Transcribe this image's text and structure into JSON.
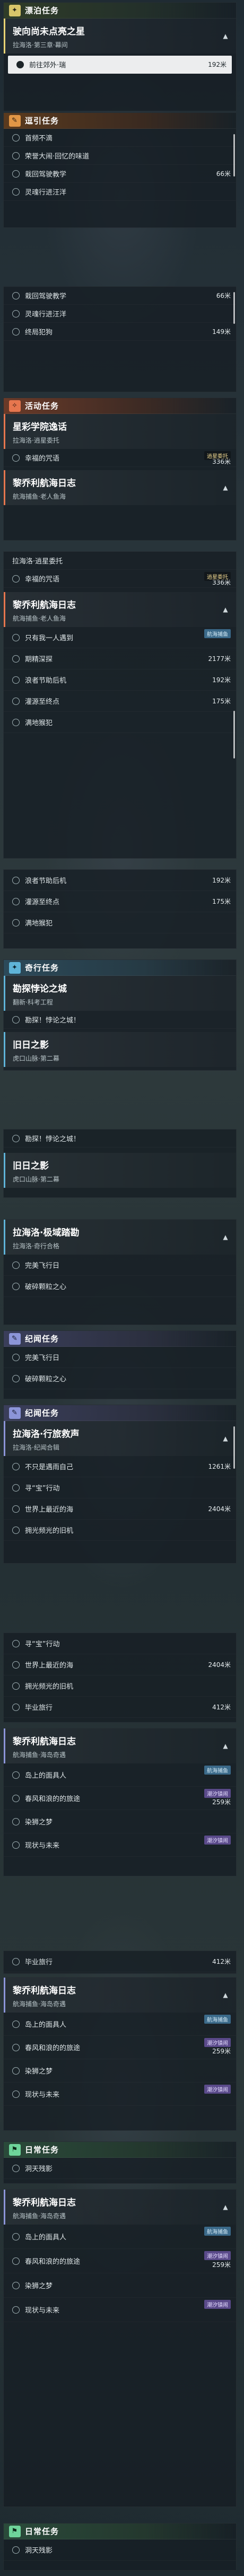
{
  "sections": {
    "trial": {
      "label": "漂泊任务",
      "icon": "✦"
    },
    "explore": {
      "label": "逗引任务",
      "icon": "✎"
    },
    "event": {
      "label": "活动任务",
      "icon": "✧"
    },
    "companion": {
      "label": "奇行任务",
      "icon": "✦"
    },
    "record": {
      "label": "纪闻任务",
      "icon": "✎"
    },
    "record2": {
      "label": "纪闻任务",
      "icon": "✎"
    },
    "daily": {
      "label": "日常任务",
      "icon": "⚑"
    },
    "daily2": {
      "label": "日常任务",
      "icon": "⚑"
    }
  },
  "q1": {
    "title": "驶向尚未点亮之星",
    "sub": "拉海洛·第三章·幕间",
    "steps": [
      {
        "label": "前往郊外·瑞",
        "dist": "192米"
      }
    ]
  },
  "explore_steps_a": [
    "首频不滴",
    "荣誉大闹·回忆的味道",
    "栽回驾驶教学",
    "灵魂行进汪洋"
  ],
  "explore_steps_a_dist": [
    "",
    "",
    "66米",
    ""
  ],
  "explore_steps_b": [
    "栽回驾驶教学",
    "灵魂行进汪洋",
    "终局犯狗"
  ],
  "explore_steps_b_dist": [
    "66米",
    "",
    "149米"
  ],
  "q2": {
    "title": "星彩学院逸话",
    "sub": "拉海洛·逍星委托",
    "step": "幸福的咒语",
    "dist": "336米",
    "tag": "逍星委托"
  },
  "q3": {
    "title": "黎乔利航海日志",
    "sub": "航海捕鱼·老人鱼海"
  },
  "q2b": {
    "sub": "拉海洛·逍星委托",
    "step": "幸福的咒语",
    "dist": "336米",
    "tag": "逍星委托"
  },
  "q3b": {
    "title": "黎乔利航海日志",
    "sub": "航海捕鱼·老人鱼海",
    "tag": "航海捕鱼",
    "steps": [
      {
        "label": "只有我一人遇到",
        "dist": ""
      },
      {
        "label": "期精深探",
        "dist": "2177米"
      },
      {
        "label": "浪者节助后机",
        "dist": "192米"
      },
      {
        "label": "灌源至终点",
        "dist": "175米"
      },
      {
        "label": "满地猴犯",
        "dist": ""
      }
    ]
  },
  "q3c": {
    "steps": [
      {
        "label": "浪者节助后机",
        "dist": "192米"
      },
      {
        "label": "灌源至终点",
        "dist": "175米"
      },
      {
        "label": "满地猴犯",
        "dist": ""
      }
    ]
  },
  "q4": {
    "title": "勘探悖论之城",
    "sub": "翻新·科考工程",
    "step": "勘探！悖论之城！"
  },
  "q5": {
    "title": "旧日之影",
    "sub": "虎口山脉·第二幕"
  },
  "q4b": {
    "step": "勘探！悖论之城！"
  },
  "q5b": {
    "title": "旧日之影",
    "sub": "虎口山脉·第二幕"
  },
  "q6": {
    "title": "拉海洛·极域踏勘",
    "sub": "拉海洛·奇行合格",
    "steps": [
      "完美飞行日",
      "破碎颗粒之心"
    ]
  },
  "q6b": {
    "steps": [
      "完美飞行日",
      "破碎颗粒之心"
    ]
  },
  "q7": {
    "title": "拉海洛·行旅救声",
    "sub": "拉海洛·纪闻合辑",
    "steps": [
      {
        "label": "不只是遇雨自己",
        "dist": "1261米"
      },
      {
        "label": "寻“宝”行动",
        "dist": ""
      },
      {
        "label": "世界上最近的海",
        "dist": "2404米"
      },
      {
        "label": "拥光频光的旧机",
        "dist": ""
      }
    ]
  },
  "q7b": {
    "steps": [
      {
        "label": "寻“宝”行动",
        "dist": ""
      },
      {
        "label": "世界上最近的海",
        "dist": "2404米"
      },
      {
        "label": "拥光频光的旧机",
        "dist": ""
      },
      {
        "label": "毕业旅行",
        "dist": "412米"
      }
    ]
  },
  "q8": {
    "title": "黎乔利航海日志",
    "sub": "航海捕鱼·海岛奇遇",
    "tag": "航海捕鱼",
    "steps": [
      {
        "label": "岛上的面具人",
        "dist": "",
        "tag": ""
      },
      {
        "label": "春风和浪的的旅途",
        "dist": "259米",
        "tag": "潮汐镇闹"
      },
      {
        "label": "染狮之梦",
        "dist": "",
        "tag": ""
      },
      {
        "label": "现状与未来",
        "dist": "",
        "tag": "潮汐镇闹"
      }
    ]
  },
  "q8_pre": {
    "label": "毕业旅行",
    "dist": "412米"
  },
  "q9": {
    "title": "黎乔利航海日志",
    "sub": "航海捕鱼·海岛奇遇",
    "tag": "航海捕鱼",
    "steps": [
      {
        "label": "岛上的面具人",
        "dist": "",
        "tag": ""
      },
      {
        "label": "春风和浪的的旅途",
        "dist": "259米",
        "tag": "潮汐镇闹"
      },
      {
        "label": "染狮之梦",
        "dist": "",
        "tag": ""
      },
      {
        "label": "现状与未来",
        "dist": "",
        "tag": "潮汐镇闹"
      }
    ]
  },
  "daily_step": "洞天残影",
  "q10": {
    "title": "黎乔利航海日志",
    "sub": "航海捕鱼·海岛奇遇",
    "tag": "航海捕鱼",
    "steps": [
      {
        "label": "岛上的面具人",
        "dist": "",
        "tag": ""
      },
      {
        "label": "春风和浪的的旅途",
        "dist": "259米",
        "tag": "潮汐镇闹"
      },
      {
        "label": "染狮之梦",
        "dist": "",
        "tag": ""
      },
      {
        "label": "现状与未来",
        "dist": "",
        "tag": "潮汐镇闹"
      }
    ]
  },
  "daily_step2": "洞天残影"
}
